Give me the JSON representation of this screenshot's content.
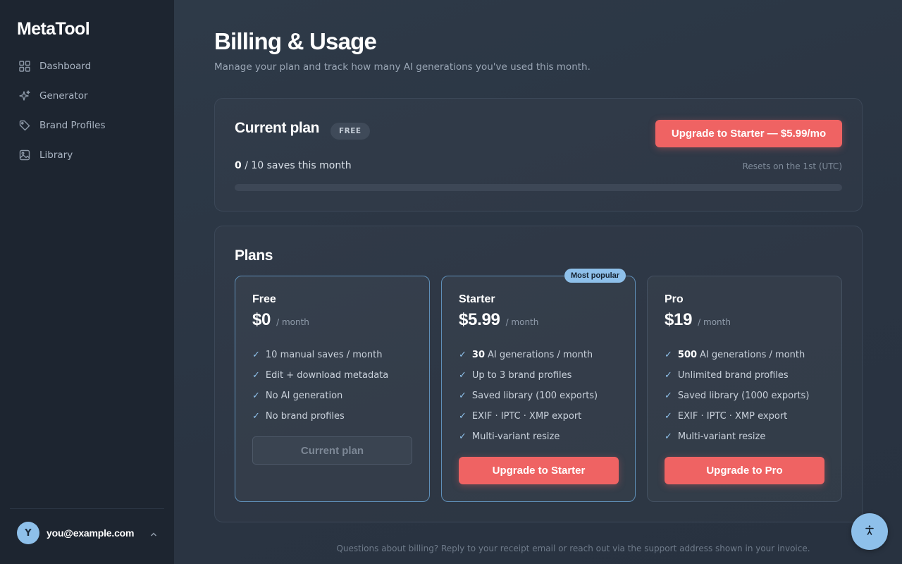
{
  "app": {
    "name": "MetaTool"
  },
  "sidebar": {
    "items": [
      {
        "label": "Dashboard",
        "icon": "grid-icon"
      },
      {
        "label": "Generator",
        "icon": "sparkle-icon"
      },
      {
        "label": "Brand Profiles",
        "icon": "tag-icon"
      },
      {
        "label": "Library",
        "icon": "image-icon"
      }
    ],
    "user": {
      "initial": "Y",
      "email": "you@example.com"
    }
  },
  "page": {
    "title": "Billing & Usage",
    "subtitle": "Manage your plan and track how many AI generations you've used this month."
  },
  "current_plan": {
    "title": "Current plan",
    "badge": "FREE",
    "upgrade_label": "Upgrade to Starter — $5.99/mo",
    "used": "0",
    "usage_suffix": "/ 10 saves this month",
    "progress_fraction": 0,
    "reset_text": "Resets on the 1st (UTC)"
  },
  "plans": {
    "title": "Plans",
    "popular_label": "Most popular",
    "check": "✓",
    "items": [
      {
        "name": "Free",
        "price": "$0",
        "period": "/ month",
        "features": [
          {
            "strong": "",
            "text": "10 manual saves / month"
          },
          {
            "strong": "",
            "text": "Edit + download metadata"
          },
          {
            "strong": "",
            "text": "No AI generation"
          },
          {
            "strong": "",
            "text": "No brand profiles"
          }
        ],
        "button": "Current plan"
      },
      {
        "name": "Starter",
        "price": "$5.99",
        "period": "/ month",
        "features": [
          {
            "strong": "30",
            "text": "AI generations / month"
          },
          {
            "strong": "",
            "text": "Up to 3 brand profiles"
          },
          {
            "strong": "",
            "text": "Saved library (100 exports)"
          },
          {
            "strong": "",
            "text": "EXIF · IPTC · XMP export"
          },
          {
            "strong": "",
            "text": "Multi-variant resize"
          }
        ],
        "button": "Upgrade to Starter"
      },
      {
        "name": "Pro",
        "price": "$19",
        "period": "/ month",
        "features": [
          {
            "strong": "500",
            "text": "AI generations / month"
          },
          {
            "strong": "",
            "text": "Unlimited brand profiles"
          },
          {
            "strong": "",
            "text": "Saved library (1000 exports)"
          },
          {
            "strong": "",
            "text": "EXIF · IPTC · XMP export"
          },
          {
            "strong": "",
            "text": "Multi-variant resize"
          }
        ],
        "button": "Upgrade to Pro"
      }
    ]
  },
  "footer": {
    "note": "Questions about billing? Reply to your receipt email or reach out via the support address shown in your invoice."
  },
  "colors": {
    "accent": "#ef6363",
    "highlight": "#8ec0ea",
    "sidebar_bg": "#1d2530",
    "main_bg": "#2a3442"
  }
}
